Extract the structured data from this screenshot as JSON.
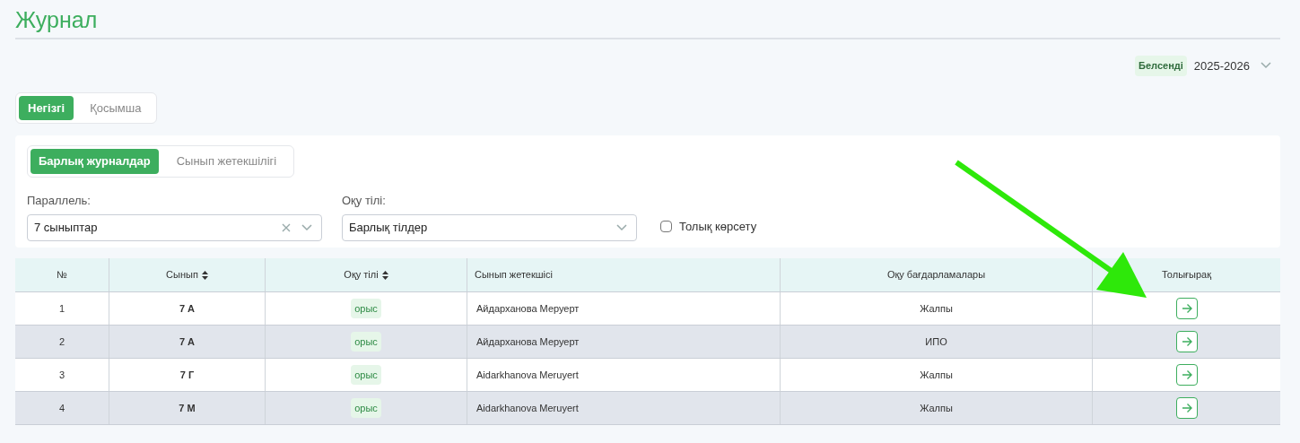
{
  "title": "Журнал",
  "year_selector": {
    "badge": "Белсенді",
    "value": "2025-2026"
  },
  "tabs": [
    {
      "label": "Негізгі",
      "selected": true
    },
    {
      "label": "Қосымша",
      "selected": false
    }
  ],
  "subtabs": [
    {
      "label": "Барлық журналдар",
      "selected": true
    },
    {
      "label": "Сынып жетекшілігі",
      "selected": false
    }
  ],
  "filters": [
    {
      "label": "Параллель:",
      "value": "7 сыныптар",
      "clearable": true
    },
    {
      "label": "Оқу тілі:",
      "value": "Барлық тілдер",
      "clearable": false
    }
  ],
  "full_view": {
    "label": "Толық көрсету",
    "checked": false
  },
  "table": {
    "columns": [
      {
        "label": "№",
        "sortable": false
      },
      {
        "label": "Сынып",
        "sortable": true
      },
      {
        "label": "Оқу тілі",
        "sortable": true
      },
      {
        "label": "Сынып жетекшісі",
        "sortable": false
      },
      {
        "label": "Оқу бағдарламалары",
        "sortable": false
      },
      {
        "label": "Толығырақ",
        "sortable": false
      }
    ],
    "rows": [
      {
        "number": "1",
        "class": "7 А",
        "language": "орыс",
        "teacher": "Айдарханова Меруерт",
        "program": "Жалпы"
      },
      {
        "number": "2",
        "class": "7 А",
        "language": "орыс",
        "teacher": "Айдарханова Меруерт",
        "program": "ИПО"
      },
      {
        "number": "3",
        "class": "7 Г",
        "language": "орыс",
        "teacher": "Aidarkhanova Meruyert",
        "program": "Жалпы"
      },
      {
        "number": "4",
        "class": "7 М",
        "language": "орыс",
        "teacher": "Aidarkhanova Meruyert",
        "program": "Жалпы"
      }
    ]
  }
}
